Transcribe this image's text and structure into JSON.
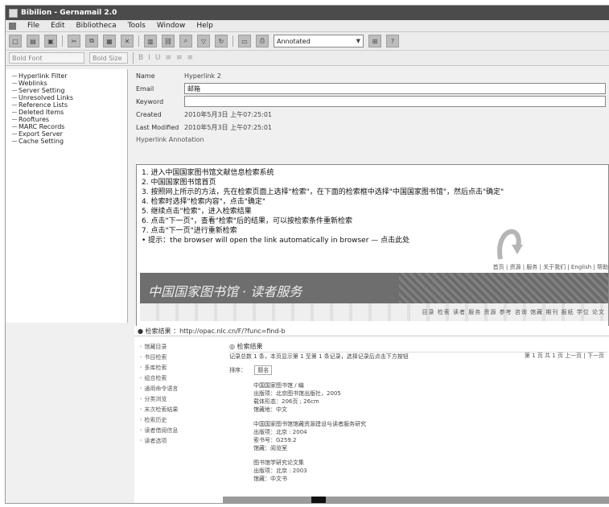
{
  "window": {
    "title": "Bibilion - Gernamail 2.0"
  },
  "menu": [
    "File",
    "Edit",
    "Bibliotheca",
    "Tools",
    "Window",
    "Help"
  ],
  "toolbar": {
    "filter_value": "Annotated",
    "help_glyph": "?"
  },
  "toolbar2": {
    "font_combo": "Bold Font",
    "size_combo": "Bold Size"
  },
  "tree": {
    "items": [
      "Hyperlink Filter",
      "Weblinks",
      "Server Setting",
      "Unresolved Links",
      "Reference Lists",
      "Deleted Items",
      "Rooftures",
      "MARC Records",
      "Export Server",
      "Cache Setting"
    ]
  },
  "fields": {
    "name_label": "Name",
    "name_value": "Hyperlink 2",
    "url_label": "Email",
    "url_value": "邮箱",
    "keyword_label": "Keyword",
    "keyword_value": "",
    "created_label": "Created",
    "created_value": "2010年5月3日 上午07:25:01",
    "modified_label": "Last Modified",
    "modified_value": "2010年5月3日 上午07:25:01",
    "section_label": "Hyperlink Annotation"
  },
  "description": {
    "lines": [
      "1. 进入中国国家图书馆文献信息检索系统",
      "2. 中国国家图书馆首页",
      "3. 按照网上所示的方法，先在检索页面上选择\"检索\"，在下面的检索框中选择\"中国国家图书馆\"，然后点击\"确定\"",
      "4. 检索时选择\"检索内容\"，点击\"确定\"",
      "5. 继续点击\"检索\"，进入检索结果",
      "6. 点击\"下一页\"，查看\"检索\"后的结果，可以按检索条件重新检索",
      "7. 点击\"下一页\"进行重新检索",
      "• 提示：the browser will open the link automatically in browser — 点击此处"
    ],
    "strip": "首页  |  资源  |  服务  |  关于我们  |  English  |  帮助",
    "banner_text": "中国国家图书馆 · 读者服务",
    "subnav": "目录 检索 读者 服务 资源 参考 咨询 馆藏 期刊 报纸 学位 论文"
  },
  "webpage": {
    "header": "● 检索结果 ：http://opac.nlc.cn/F/?func=find-b",
    "side": [
      "◦ 馆藏目录",
      "◦ 书目检索",
      "◦ 多库检索",
      "◦ 组合检索",
      "◦ 通用命令语言",
      "◦ 分类浏览",
      "◦ 末次检索结果",
      "◦ 检索历史",
      "◦ 读者借阅信息",
      "◦ 读者选项"
    ],
    "title": "◎ 检索结果",
    "intro": "记录总数 1 条，本页显示第 1 至第 1 条记录，选择记录后点击下方按钮",
    "sort_label": "排序：",
    "sort_value": "题名",
    "pager": "第 1 页 共 1 页  上一页 | 下一页",
    "records": [
      [
        "中国国家图书馆 / 编",
        "出版项：北京图书馆出版社，2005",
        "载体形态：206页 ; 26cm",
        "馆藏地：中文"
      ],
      [
        "中国国家图书馆馆藏资源建设与读者服务研究",
        "出版项：北京 : 2004",
        "索书号：G259.2",
        "馆藏：阅览室"
      ],
      [
        "图书馆学研究论文集",
        "出版项：北京 : 2003",
        "馆藏：中文书"
      ]
    ]
  },
  "colors": {
    "titlebar": "#4b4b4b",
    "banner": "#6e6e6e"
  }
}
